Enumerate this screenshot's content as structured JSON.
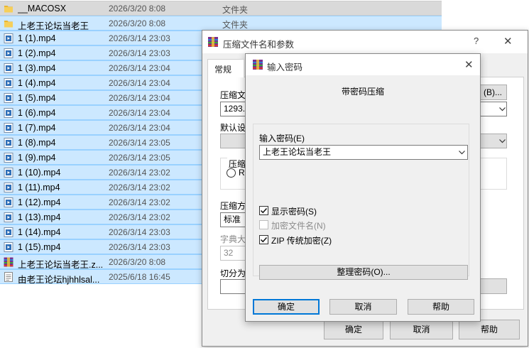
{
  "files": [
    {
      "name": "__MACOSX",
      "date": "2026/3/20 8:08",
      "type": "文件夹",
      "icon": "folder-icon"
    },
    {
      "name": "上老王论坛当老王",
      "date": "2026/3/20 8:08",
      "type": "文件夹",
      "icon": "folder-icon"
    },
    {
      "name": "1 (1).mp4",
      "date": "2026/3/14 23:03",
      "type": "",
      "icon": "video-file-icon"
    },
    {
      "name": "1 (2).mp4",
      "date": "2026/3/14 23:03",
      "type": "",
      "icon": "video-file-icon"
    },
    {
      "name": "1 (3).mp4",
      "date": "2026/3/14 23:04",
      "type": "",
      "icon": "video-file-icon"
    },
    {
      "name": "1 (4).mp4",
      "date": "2026/3/14 23:04",
      "type": "",
      "icon": "video-file-icon"
    },
    {
      "name": "1 (5).mp4",
      "date": "2026/3/14 23:04",
      "type": "",
      "icon": "video-file-icon"
    },
    {
      "name": "1 (6).mp4",
      "date": "2026/3/14 23:04",
      "type": "",
      "icon": "video-file-icon"
    },
    {
      "name": "1 (7).mp4",
      "date": "2026/3/14 23:04",
      "type": "",
      "icon": "video-file-icon"
    },
    {
      "name": "1 (8).mp4",
      "date": "2026/3/14 23:05",
      "type": "",
      "icon": "video-file-icon"
    },
    {
      "name": "1 (9).mp4",
      "date": "2026/3/14 23:05",
      "type": "",
      "icon": "video-file-icon"
    },
    {
      "name": "1 (10).mp4",
      "date": "2026/3/14 23:02",
      "type": "",
      "icon": "video-file-icon"
    },
    {
      "name": "1 (11).mp4",
      "date": "2026/3/14 23:02",
      "type": "",
      "icon": "video-file-icon"
    },
    {
      "name": "1 (12).mp4",
      "date": "2026/3/14 23:02",
      "type": "",
      "icon": "video-file-icon"
    },
    {
      "name": "1 (13).mp4",
      "date": "2026/3/14 23:02",
      "type": "",
      "icon": "video-file-icon"
    },
    {
      "name": "1 (14).mp4",
      "date": "2026/3/14 23:03",
      "type": "",
      "icon": "video-file-icon"
    },
    {
      "name": "1 (15).mp4",
      "date": "2026/3/14 23:03",
      "type": "",
      "icon": "video-file-icon"
    },
    {
      "name": "上老王论坛当老王.z...",
      "date": "2026/3/20 8:08",
      "type": "",
      "icon": "winrar-archive-icon"
    },
    {
      "name": "由老王论坛hjhhlsal...",
      "date": "2025/6/18 16:45",
      "type": "",
      "icon": "text-file-icon"
    }
  ],
  "archive_dialog": {
    "title": "压缩文件名和参数",
    "help_glyph": "?",
    "close_glyph": "✕",
    "tab_general": "常规",
    "archive_name_label": "压缩文",
    "archive_name_value": "1293.z",
    "browse_button": "(B)...",
    "default_profile_label": "默认设",
    "format_group_label": "压缩",
    "format_radio_label": "R",
    "method_label": "压缩方",
    "method_value": "标准",
    "dict_label": "字典大",
    "dict_value": "32",
    "split_label": "切分为",
    "ok_button": "确定",
    "cancel_button": "取消",
    "help_button": "帮助"
  },
  "password_dialog": {
    "title": "输入密码",
    "close_glyph": "✕",
    "heading": "带密码压缩",
    "password_label": "输入密码(E)",
    "password_value": "上老王论坛当老王",
    "show_password": {
      "label": "显示密码(S)",
      "checked": true
    },
    "encrypt_filenames": {
      "label": "加密文件名(N)",
      "checked": false,
      "disabled": true
    },
    "zip_legacy": {
      "label": "ZIP 传统加密(Z)",
      "checked": true
    },
    "organize_button": "整理密码(O)...",
    "ok_button": "确定",
    "cancel_button": "取消",
    "help_button": "帮助"
  },
  "colors": {
    "selection": "#cce8ff",
    "selection_border": "#99d1ff",
    "dialog_bg": "#f0f0f0",
    "folder": "#e8b530",
    "video_icon": "#2f6fb8"
  }
}
